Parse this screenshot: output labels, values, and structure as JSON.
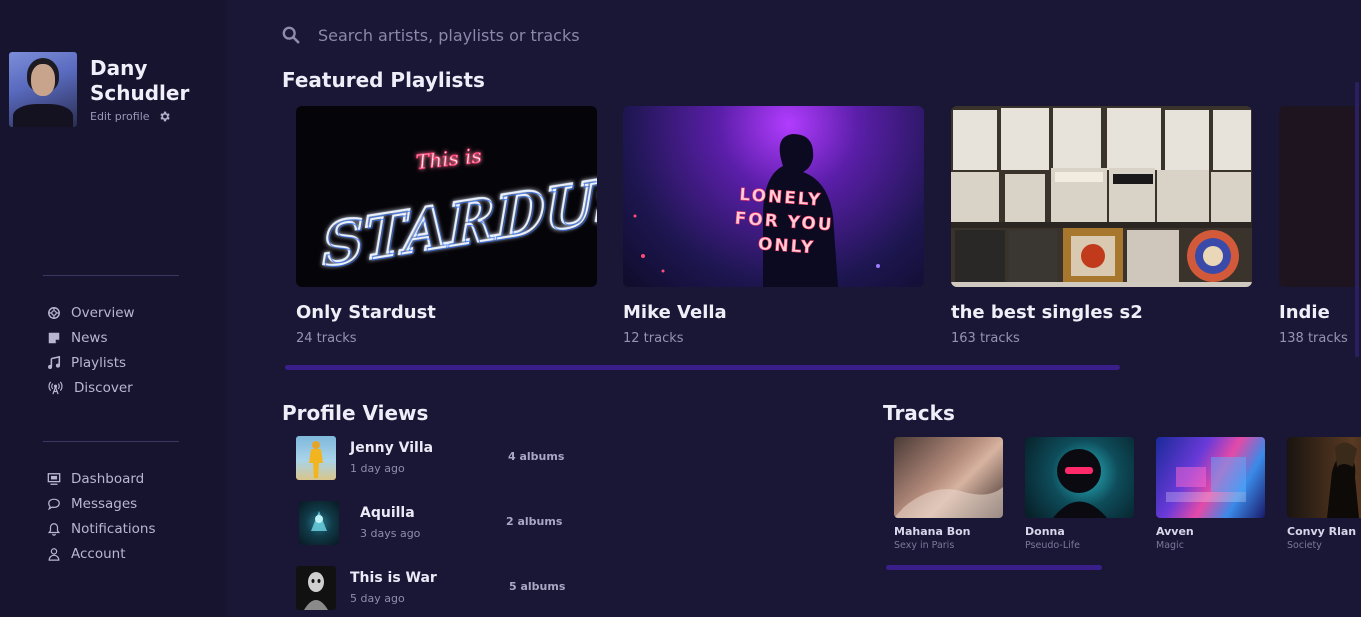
{
  "user": {
    "name": "Dany Schudler",
    "edit_profile": "Edit profile"
  },
  "nav_primary": [
    {
      "label": "Overview",
      "icon": "overview-icon"
    },
    {
      "label": "News",
      "icon": "news-icon"
    },
    {
      "label": "Playlists",
      "icon": "music-note-icon"
    },
    {
      "label": "Discover",
      "icon": "broadcast-icon"
    }
  ],
  "nav_secondary": [
    {
      "label": "Dashboard",
      "icon": "dashboard-icon"
    },
    {
      "label": "Messages",
      "icon": "message-icon"
    },
    {
      "label": "Notifications",
      "icon": "bell-icon"
    },
    {
      "label": "Account",
      "icon": "user-icon"
    }
  ],
  "search": {
    "placeholder": "Search artists, playlists or tracks"
  },
  "featured": {
    "title": "Featured Playlists",
    "playlists": [
      {
        "name": "Only Stardust",
        "count": "24 tracks",
        "cover_text_1": "This is",
        "cover_text_2": "STARDUST"
      },
      {
        "name": "Mike Vella",
        "count": "12 tracks",
        "cover_text": "LONELY FOR YOU ONLY"
      },
      {
        "name": "the best singles s2",
        "count": "163 tracks"
      },
      {
        "name": "Indie",
        "count": "138 tracks"
      }
    ]
  },
  "profile_views": {
    "title": "Profile Views",
    "items": [
      {
        "name": "Jenny Villa",
        "time": "1 day ago",
        "albums": "4 albums"
      },
      {
        "name": "Aquilla",
        "time": "3 days ago",
        "albums": "2 albums"
      },
      {
        "name": "This is War",
        "time": "5 day ago",
        "albums": "5 albums"
      }
    ]
  },
  "tracks": {
    "title": "Tracks",
    "items": [
      {
        "title": "Mahana Bon",
        "subtitle": "Sexy in Paris"
      },
      {
        "title": "Donna",
        "subtitle": "Pseudo-Life"
      },
      {
        "title": "Avven",
        "subtitle": "Magic"
      },
      {
        "title": "Convy Rlan",
        "subtitle": "Society"
      }
    ]
  },
  "colors": {
    "background": "#1a1636",
    "sidebar": "#17142f",
    "accent_scrollbar": "#3a1f8a"
  }
}
